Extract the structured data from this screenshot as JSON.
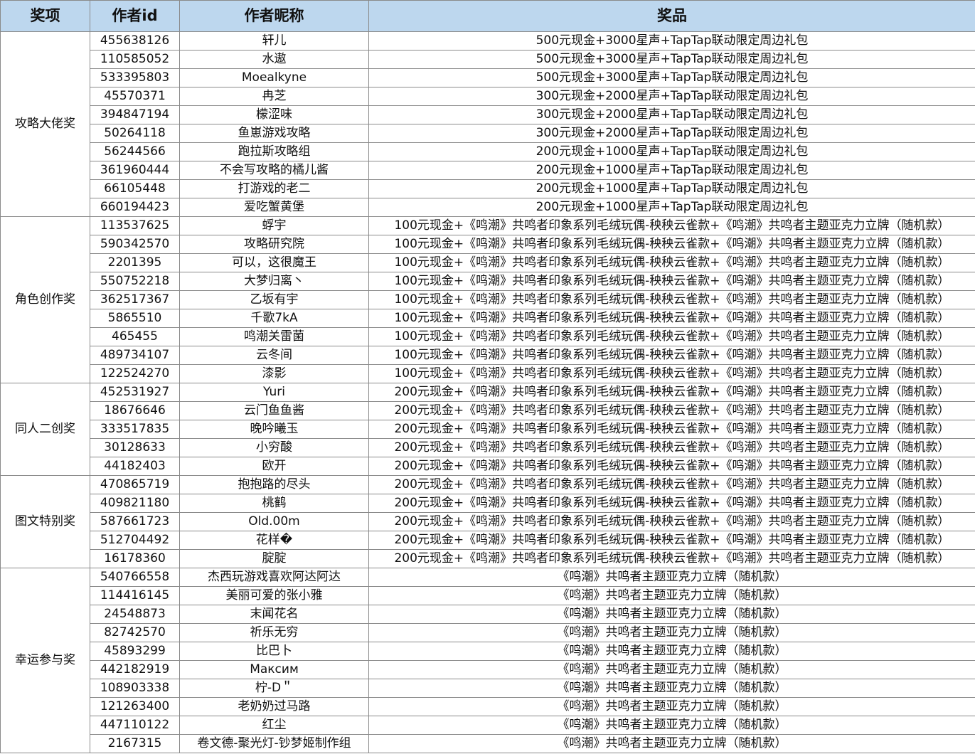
{
  "headers": {
    "award": "奖项",
    "author_id": "作者id",
    "nickname": "作者昵称",
    "prize": "奖品"
  },
  "groups": [
    {
      "award": "攻略大佬奖",
      "rows": [
        {
          "id": "455638126",
          "nickname": "轩儿",
          "prize": "500元现金+3000星声+TapTap联动限定周边礼包"
        },
        {
          "id": "110585052",
          "nickname": "水遨",
          "prize": "500元现金+3000星声+TapTap联动限定周边礼包"
        },
        {
          "id": "533395803",
          "nickname": "Moealkyne",
          "prize": "500元现金+3000星声+TapTap联动限定周边礼包"
        },
        {
          "id": "45570371",
          "nickname": "冉芝",
          "prize": "300元现金+2000星声+TapTap联动限定周边礼包"
        },
        {
          "id": "394847194",
          "nickname": "檬涩味",
          "prize": "300元现金+2000星声+TapTap联动限定周边礼包"
        },
        {
          "id": "50264118",
          "nickname": "鱼崽游戏攻略",
          "prize": "300元现金+2000星声+TapTap联动限定周边礼包"
        },
        {
          "id": "56244566",
          "nickname": "跑拉斯攻略组",
          "prize": "200元现金+1000星声+TapTap联动限定周边礼包"
        },
        {
          "id": "361960444",
          "nickname": "不会写攻略的橘儿酱",
          "prize": "200元现金+1000星声+TapTap联动限定周边礼包"
        },
        {
          "id": "66105448",
          "nickname": "打游戏的老二",
          "prize": "200元现金+1000星声+TapTap联动限定周边礼包"
        },
        {
          "id": "660194423",
          "nickname": "爱吃蟹黄堡",
          "prize": "200元现金+1000星声+TapTap联动限定周边礼包"
        }
      ]
    },
    {
      "award": "角色创作奖",
      "rows": [
        {
          "id": "113537625",
          "nickname": "蜉宇",
          "prize": "100元现金+《鸣潮》共鸣者印象系列毛绒玩偶-秧秧云雀款+《鸣潮》共鸣者主题亚克力立牌（随机款）"
        },
        {
          "id": "590342570",
          "nickname": "攻略研究院",
          "prize": "100元现金+《鸣潮》共鸣者印象系列毛绒玩偶-秧秧云雀款+《鸣潮》共鸣者主题亚克力立牌（随机款）"
        },
        {
          "id": "2201395",
          "nickname": "可以，这很魔王",
          "prize": "100元现金+《鸣潮》共鸣者印象系列毛绒玩偶-秧秧云雀款+《鸣潮》共鸣者主题亚克力立牌（随机款）"
        },
        {
          "id": "550752218",
          "nickname": "大梦归离丶",
          "prize": "100元现金+《鸣潮》共鸣者印象系列毛绒玩偶-秧秧云雀款+《鸣潮》共鸣者主题亚克力立牌（随机款）"
        },
        {
          "id": "362517367",
          "nickname": "乙坂有宇",
          "prize": "100元现金+《鸣潮》共鸣者印象系列毛绒玩偶-秧秧云雀款+《鸣潮》共鸣者主题亚克力立牌（随机款）"
        },
        {
          "id": "5865510",
          "nickname": "千歌7kA",
          "prize": "100元现金+《鸣潮》共鸣者印象系列毛绒玩偶-秧秧云雀款+《鸣潮》共鸣者主题亚克力立牌（随机款）"
        },
        {
          "id": "465455",
          "nickname": "鸣潮关雷菌",
          "prize": "100元现金+《鸣潮》共鸣者印象系列毛绒玩偶-秧秧云雀款+《鸣潮》共鸣者主题亚克力立牌（随机款）"
        },
        {
          "id": "489734107",
          "nickname": "云冬间",
          "prize": "100元现金+《鸣潮》共鸣者印象系列毛绒玩偶-秧秧云雀款+《鸣潮》共鸣者主题亚克力立牌（随机款）"
        },
        {
          "id": "122524270",
          "nickname": "漆影",
          "prize": "100元现金+《鸣潮》共鸣者印象系列毛绒玩偶-秧秧云雀款+《鸣潮》共鸣者主题亚克力立牌（随机款）"
        }
      ]
    },
    {
      "award": "同人二创奖",
      "rows": [
        {
          "id": "452531927",
          "nickname": "Yuri",
          "prize": "200元现金+《鸣潮》共鸣者印象系列毛绒玩偶-秧秧云雀款+《鸣潮》共鸣者主题亚克力立牌（随机款）"
        },
        {
          "id": "18676646",
          "nickname": "云门鱼鱼酱",
          "prize": "200元现金+《鸣潮》共鸣者印象系列毛绒玩偶-秧秧云雀款+《鸣潮》共鸣者主题亚克力立牌（随机款）"
        },
        {
          "id": "333517835",
          "nickname": "晚吟曦玉",
          "prize": "200元现金+《鸣潮》共鸣者印象系列毛绒玩偶-秧秧云雀款+《鸣潮》共鸣者主题亚克力立牌（随机款）"
        },
        {
          "id": "30128633",
          "nickname": "小穷酸",
          "prize": "200元现金+《鸣潮》共鸣者印象系列毛绒玩偶-秧秧云雀款+《鸣潮》共鸣者主题亚克力立牌（随机款）"
        },
        {
          "id": "44182403",
          "nickname": "欧开",
          "prize": "200元现金+《鸣潮》共鸣者印象系列毛绒玩偶-秧秧云雀款+《鸣潮》共鸣者主题亚克力立牌（随机款）"
        }
      ]
    },
    {
      "award": "图文特别奖",
      "rows": [
        {
          "id": "470865719",
          "nickname": "抱抱路的尽头",
          "prize": "200元现金+《鸣潮》共鸣者印象系列毛绒玩偶-秧秧云雀款+《鸣潮》共鸣者主题亚克力立牌（随机款）"
        },
        {
          "id": "409821180",
          "nickname": "桃鹤",
          "prize": "200元现金+《鸣潮》共鸣者印象系列毛绒玩偶-秧秧云雀款+《鸣潮》共鸣者主题亚克力立牌（随机款）"
        },
        {
          "id": "587661723",
          "nickname": "Old.00m",
          "prize": "200元现金+《鸣潮》共鸣者印象系列毛绒玩偶-秧秧云雀款+《鸣潮》共鸣者主题亚克力立牌（随机款）"
        },
        {
          "id": "512704492",
          "nickname": "花样�",
          "prize": "200元现金+《鸣潮》共鸣者印象系列毛绒玩偶-秧秧云雀款+《鸣潮》共鸣者主题亚克力立牌（随机款）"
        },
        {
          "id": "16178360",
          "nickname": "腚腚",
          "prize": "200元现金+《鸣潮》共鸣者印象系列毛绒玩偶-秧秧云雀款+《鸣潮》共鸣者主题亚克力立牌（随机款）"
        }
      ]
    },
    {
      "award": "幸运参与奖",
      "rows": [
        {
          "id": "540766558",
          "nickname": "杰西玩游戏喜欢阿达阿达",
          "prize": "《鸣潮》共鸣者主题亚克力立牌（随机款）"
        },
        {
          "id": "114416145",
          "nickname": "美丽可爱的张小雅",
          "prize": "《鸣潮》共鸣者主题亚克力立牌（随机款）"
        },
        {
          "id": "24548873",
          "nickname": "末闻花名",
          "prize": "《鸣潮》共鸣者主题亚克力立牌（随机款）"
        },
        {
          "id": "82742570",
          "nickname": "祈乐无穷",
          "prize": "《鸣潮》共鸣者主题亚克力立牌（随机款）"
        },
        {
          "id": "45893299",
          "nickname": "比巴卜",
          "prize": "《鸣潮》共鸣者主题亚克力立牌（随机款）"
        },
        {
          "id": "442182919",
          "nickname": "Максим",
          "prize": "《鸣潮》共鸣者主题亚克力立牌（随机款）"
        },
        {
          "id": "108903338",
          "nickname": "柠-D＂",
          "prize": "《鸣潮》共鸣者主题亚克力立牌（随机款）"
        },
        {
          "id": "121263400",
          "nickname": "老奶奶过马路",
          "prize": "《鸣潮》共鸣者主题亚克力立牌（随机款）"
        },
        {
          "id": "447110122",
          "nickname": "红尘",
          "prize": "《鸣潮》共鸣者主题亚克力立牌（随机款）"
        },
        {
          "id": "2167315",
          "nickname": "卷文德-聚光灯-钞梦姬制作组",
          "prize": "《鸣潮》共鸣者主题亚克力立牌（随机款）"
        }
      ]
    }
  ]
}
